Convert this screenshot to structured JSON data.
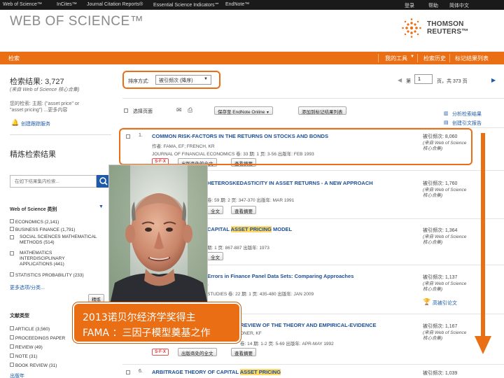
{
  "topbar": {
    "items": [
      "Web of Science™",
      "InCites™",
      "Journal Citation Reports®",
      "Essential Science Indicators℠",
      "EndNote™"
    ],
    "right": [
      "登录",
      "帮助",
      "简体中文"
    ]
  },
  "header": {
    "logo": "WEB OF SCIENCE™",
    "brand": "THOMSON REUTERS™"
  },
  "nav": {
    "search": "检索",
    "tools": "我的工具",
    "history": "检索历史",
    "marked": "标记结果列表"
  },
  "left": {
    "results_count": "检索结果: 3,727",
    "results_source": "(来自 Web of Science 核心合集)",
    "query_label": "您的检索: 主题: (\"asset price\" or",
    "query_line2": "\"asset pricing\") ...更多内容",
    "alert": "创建跟踪服务",
    "refine_title": "精炼检索结果",
    "refine_placeholder": "在如下结果集内检索...",
    "cat_title": "Web of Science 类别",
    "categories": [
      "ECONOMICS (2,141)",
      "BUSINESS FINANCE (1,791)",
      "SOCIAL SCIENCES MATHEMATICAL METHODS (514)",
      "MATHEMATICS INTERDISCIPLINARY APPLICATIONS (441)",
      "STATISTICS PROBABILITY (233)"
    ],
    "more": "更多选项/分类...",
    "refine_btn": "精炼",
    "doctype_title": "文献类型",
    "doctypes": [
      "ARTICLE (3,560)",
      "PROCEEDINGS PAPER",
      "REVIEW (49)",
      "NOTE (31)",
      "BOOK REVIEW (31)"
    ],
    "more2": "出版年"
  },
  "toolbar": {
    "sort_label": "排序方式:",
    "sort_value": "被引频次 (降序)",
    "page_label": "第",
    "page_value": "1",
    "page_total": "页，共 373 页",
    "select_page": "选择页面",
    "save_label": "保存至 EndNote Online",
    "add_marked": "添加到标记结果列表",
    "analyze": "分析检索结果",
    "citation_report": "创建引文报告"
  },
  "results": [
    {
      "num": "1.",
      "title": "COMMON RISK-FACTORS IN THE RETURNS ON STOCKS AND BONDS",
      "meta1": "作者: FAMA, EF; FRENCH, KR",
      "meta2": "JOURNAL OF FINANCIAL ECONOMICS 卷: 33 期: 1 页: 3-56 出版年: FEB 1993",
      "times_cited": "被引频次: 8,060",
      "cite_src": "(来自 Web of Science 核心合集)",
      "btn1": "出版商处的全文",
      "btn2": "查看摘要"
    },
    {
      "num": "2.",
      "title": "HETEROSKEDASTICITY IN ASSET RETURNS - A NEW APPROACH",
      "meta1": "卷: 59 期: 2 页: 347-370 出版年: MAR 1991",
      "times_cited": "被引频次: 1,760",
      "cite_src": "(来自 Web of Science 核心合集)",
      "btn1": "全文",
      "btn2": "查看摘要"
    },
    {
      "num": "3.",
      "title_pre": "CAPITAL ",
      "title_hl": "ASSET PRICING",
      "title_post": " MODEL",
      "meta1": "期: 1 页: 867-887 出版年: 1973",
      "times_cited": "被引频次: 1,364",
      "cite_src": "(来自 Web of Science 核心合集)",
      "btn1": "全文"
    },
    {
      "num": "4.",
      "title": "Errors in Finance Panel Data Sets: Comparing Approaches",
      "meta1": "STUDIES 卷: 22 期: 1 页: 435-480 出版年: JAN 2009",
      "times_cited": "被引频次: 1,137",
      "cite_src": "(来自 Web of Science 核心合集)",
      "highly_cited": "高被引论文"
    },
    {
      "num": "5.",
      "title": "A REVIEW OF THE THEORY AND EMPIRICAL-EVIDENCE",
      "meta1": "ONER, KF",
      "meta2": "卷: 14 期: 1-2 页: 5-69 出版年: APR-MAY 1992",
      "times_cited": "被引频次: 1,167",
      "cite_src": "(来自 Web of Science 核心合集)",
      "btn1": "出版商处的全文",
      "btn2": "查看摘要"
    },
    {
      "num": "6.",
      "title_pre": "ARBITRAGE THEORY OF CAPITAL ",
      "title_hl": "ASSET PRICING",
      "times_cited": "被引频次: 1,039"
    }
  ],
  "overlay": {
    "caption_line1": "2013诺贝尔经济学奖得主",
    "caption_line2": "FAMA ：三因子模型奠基之作"
  },
  "colors": {
    "accent": "#ea6e14",
    "link": "#1d5aa8",
    "highlight": "#ffd966"
  }
}
